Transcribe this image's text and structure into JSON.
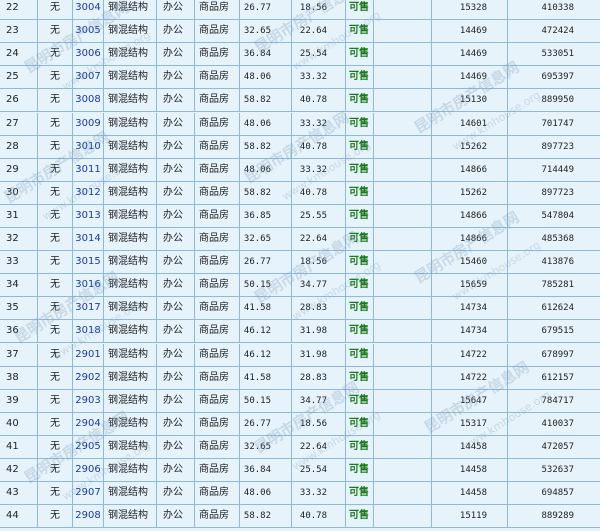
{
  "rows": [
    {
      "idx": "22",
      "none": "无",
      "room": "3004",
      "struct": "钢混结构",
      "use": "办公",
      "type": "商品房",
      "area1": "26.77",
      "area2": "18.56",
      "status": "可售",
      "price": "15328",
      "total": "410338"
    },
    {
      "idx": "23",
      "none": "无",
      "room": "3005",
      "struct": "钢混结构",
      "use": "办公",
      "type": "商品房",
      "area1": "32.65",
      "area2": "22.64",
      "status": "可售",
      "price": "14469",
      "total": "472424"
    },
    {
      "idx": "24",
      "none": "无",
      "room": "3006",
      "struct": "钢混结构",
      "use": "办公",
      "type": "商品房",
      "area1": "36.84",
      "area2": "25.54",
      "status": "可售",
      "price": "14469",
      "total": "533051"
    },
    {
      "idx": "25",
      "none": "无",
      "room": "3007",
      "struct": "钢混结构",
      "use": "办公",
      "type": "商品房",
      "area1": "48.06",
      "area2": "33.32",
      "status": "可售",
      "price": "14469",
      "total": "695397"
    },
    {
      "idx": "26",
      "none": "无",
      "room": "3008",
      "struct": "钢混结构",
      "use": "办公",
      "type": "商品房",
      "area1": "58.82",
      "area2": "40.78",
      "status": "可售",
      "price": "15130",
      "total": "889950"
    },
    {
      "idx": "27",
      "none": "无",
      "room": "3009",
      "struct": "钢混结构",
      "use": "办公",
      "type": "商品房",
      "area1": "48.06",
      "area2": "33.32",
      "status": "可售",
      "price": "14601",
      "total": "701747"
    },
    {
      "idx": "28",
      "none": "无",
      "room": "3010",
      "struct": "钢混结构",
      "use": "办公",
      "type": "商品房",
      "area1": "58.82",
      "area2": "40.78",
      "status": "可售",
      "price": "15262",
      "total": "897723"
    },
    {
      "idx": "29",
      "none": "无",
      "room": "3011",
      "struct": "钢混结构",
      "use": "办公",
      "type": "商品房",
      "area1": "48.06",
      "area2": "33.32",
      "status": "可售",
      "price": "14866",
      "total": "714449"
    },
    {
      "idx": "30",
      "none": "无",
      "room": "3012",
      "struct": "钢混结构",
      "use": "办公",
      "type": "商品房",
      "area1": "58.82",
      "area2": "40.78",
      "status": "可售",
      "price": "15262",
      "total": "897723"
    },
    {
      "idx": "31",
      "none": "无",
      "room": "3013",
      "struct": "钢混结构",
      "use": "办公",
      "type": "商品房",
      "area1": "36.85",
      "area2": "25.55",
      "status": "可售",
      "price": "14866",
      "total": "547804"
    },
    {
      "idx": "32",
      "none": "无",
      "room": "3014",
      "struct": "钢混结构",
      "use": "办公",
      "type": "商品房",
      "area1": "32.65",
      "area2": "22.64",
      "status": "可售",
      "price": "14866",
      "total": "485368"
    },
    {
      "idx": "33",
      "none": "无",
      "room": "3015",
      "struct": "钢混结构",
      "use": "办公",
      "type": "商品房",
      "area1": "26.77",
      "area2": "18.56",
      "status": "可售",
      "price": "15460",
      "total": "413876"
    },
    {
      "idx": "34",
      "none": "无",
      "room": "3016",
      "struct": "钢混结构",
      "use": "办公",
      "type": "商品房",
      "area1": "50.15",
      "area2": "34.77",
      "status": "可售",
      "price": "15659",
      "total": "785281"
    },
    {
      "idx": "35",
      "none": "无",
      "room": "3017",
      "struct": "钢混结构",
      "use": "办公",
      "type": "商品房",
      "area1": "41.58",
      "area2": "28.83",
      "status": "可售",
      "price": "14734",
      "total": "612624"
    },
    {
      "idx": "36",
      "none": "无",
      "room": "3018",
      "struct": "钢混结构",
      "use": "办公",
      "type": "商品房",
      "area1": "46.12",
      "area2": "31.98",
      "status": "可售",
      "price": "14734",
      "total": "679515"
    },
    {
      "idx": "37",
      "none": "无",
      "room": "2901",
      "struct": "钢混结构",
      "use": "办公",
      "type": "商品房",
      "area1": "46.12",
      "area2": "31.98",
      "status": "可售",
      "price": "14722",
      "total": "678997"
    },
    {
      "idx": "38",
      "none": "无",
      "room": "2902",
      "struct": "钢混结构",
      "use": "办公",
      "type": "商品房",
      "area1": "41.58",
      "area2": "28.83",
      "status": "可售",
      "price": "14722",
      "total": "612157"
    },
    {
      "idx": "39",
      "none": "无",
      "room": "2903",
      "struct": "钢混结构",
      "use": "办公",
      "type": "商品房",
      "area1": "50.15",
      "area2": "34.77",
      "status": "可售",
      "price": "15647",
      "total": "784717"
    },
    {
      "idx": "40",
      "none": "无",
      "room": "2904",
      "struct": "钢混结构",
      "use": "办公",
      "type": "商品房",
      "area1": "26.77",
      "area2": "18.56",
      "status": "可售",
      "price": "15317",
      "total": "410037"
    },
    {
      "idx": "41",
      "none": "无",
      "room": "2905",
      "struct": "钢混结构",
      "use": "办公",
      "type": "商品房",
      "area1": "32.65",
      "area2": "22.64",
      "status": "可售",
      "price": "14458",
      "total": "472057"
    },
    {
      "idx": "42",
      "none": "无",
      "room": "2906",
      "struct": "钢混结构",
      "use": "办公",
      "type": "商品房",
      "area1": "36.84",
      "area2": "25.54",
      "status": "可售",
      "price": "14458",
      "total": "532637"
    },
    {
      "idx": "43",
      "none": "无",
      "room": "2907",
      "struct": "钢混结构",
      "use": "办公",
      "type": "商品房",
      "area1": "48.06",
      "area2": "33.32",
      "status": "可售",
      "price": "14458",
      "total": "694857"
    },
    {
      "idx": "44",
      "none": "无",
      "room": "2908",
      "struct": "钢混结构",
      "use": "办公",
      "type": "商品房",
      "area1": "58.82",
      "area2": "40.78",
      "status": "可售",
      "price": "15119",
      "total": "889289"
    }
  ],
  "watermark": {
    "cn": "昆明市房产信息网",
    "en": "www.kmhouse.org"
  },
  "colors": {
    "background": "#e6f3fb",
    "border": "#8fb9d8",
    "room_link": "#1b3a9c",
    "status": "#1a7a1a"
  }
}
